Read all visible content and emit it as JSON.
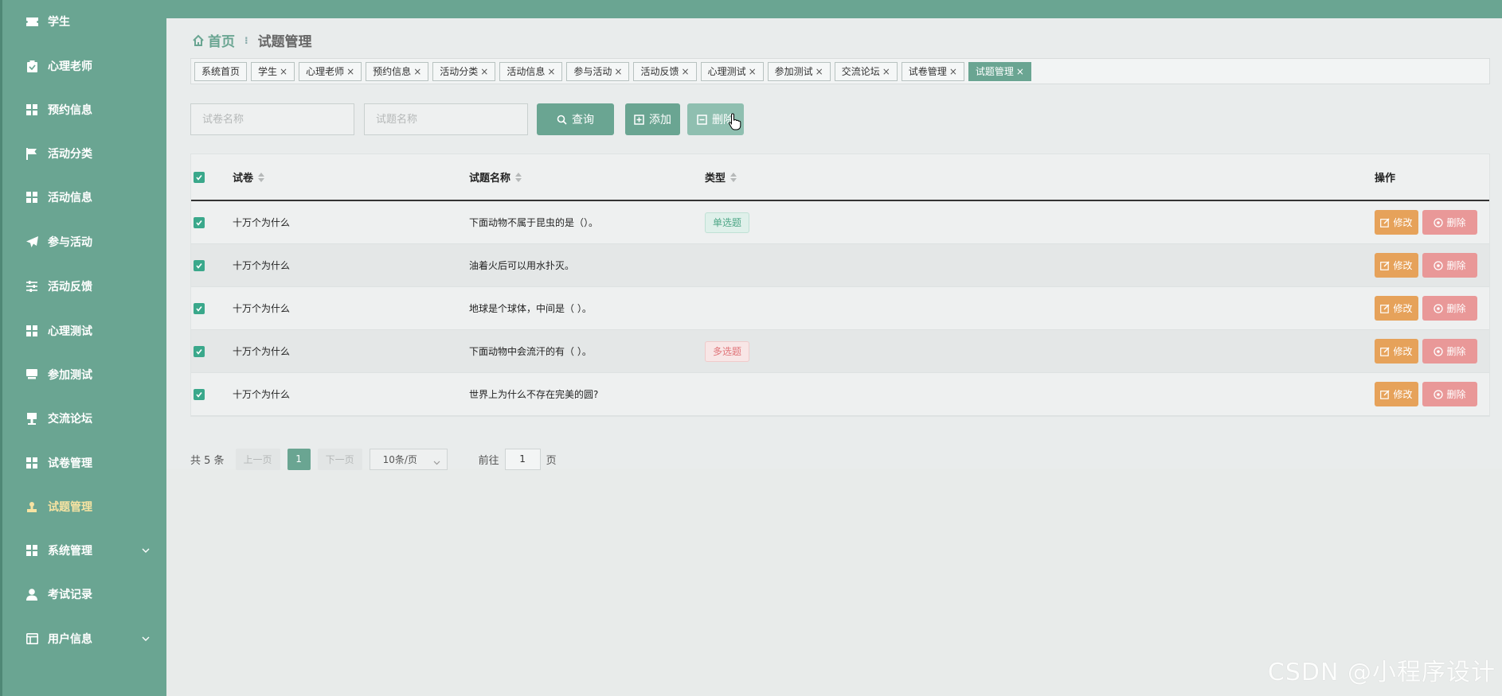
{
  "sidebar": {
    "items": [
      {
        "label": "学生",
        "icon": "ticket-icon"
      },
      {
        "label": "心理老师",
        "icon": "clipboard-icon"
      },
      {
        "label": "预约信息",
        "icon": "grid-icon"
      },
      {
        "label": "活动分类",
        "icon": "flag-icon"
      },
      {
        "label": "活动信息",
        "icon": "grid-icon"
      },
      {
        "label": "参与活动",
        "icon": "send-icon"
      },
      {
        "label": "活动反馈",
        "icon": "sliders-icon"
      },
      {
        "label": "心理测试",
        "icon": "grid-icon"
      },
      {
        "label": "参加测试",
        "icon": "monitor-icon"
      },
      {
        "label": "交流论坛",
        "icon": "podium-icon"
      },
      {
        "label": "试卷管理",
        "icon": "grid-icon"
      },
      {
        "label": "试题管理",
        "icon": "user-stamp-icon",
        "active": true
      },
      {
        "label": "系统管理",
        "icon": "grid-icon",
        "expandable": true
      },
      {
        "label": "考试记录",
        "icon": "person-icon"
      },
      {
        "label": "用户信息",
        "icon": "window-icon",
        "expandable": true
      }
    ]
  },
  "breadcrumb": {
    "home": "首页",
    "current": "试题管理"
  },
  "tags": [
    {
      "label": "系统首页",
      "closable": false
    },
    {
      "label": "学生",
      "closable": true
    },
    {
      "label": "心理老师",
      "closable": true
    },
    {
      "label": "预约信息",
      "closable": true
    },
    {
      "label": "活动分类",
      "closable": true
    },
    {
      "label": "活动信息",
      "closable": true
    },
    {
      "label": "参与活动",
      "closable": true
    },
    {
      "label": "活动反馈",
      "closable": true
    },
    {
      "label": "心理测试",
      "closable": true
    },
    {
      "label": "参加测试",
      "closable": true
    },
    {
      "label": "交流论坛",
      "closable": true
    },
    {
      "label": "试卷管理",
      "closable": true
    },
    {
      "label": "试题管理",
      "closable": true,
      "active": true
    }
  ],
  "search": {
    "paper_placeholder": "试卷名称",
    "question_placeholder": "试题名称",
    "query_label": "查询",
    "add_label": "添加",
    "delete_label": "删除"
  },
  "table": {
    "headers": {
      "paper": "试卷",
      "question": "试题名称",
      "type": "类型",
      "ops": "操作"
    },
    "edit_label": "修改",
    "delete_label": "删除",
    "rows": [
      {
        "paper": "十万个为什么",
        "question": "下面动物不属于昆虫的是（）。",
        "type": "单选题",
        "type_style": "single"
      },
      {
        "paper": "十万个为什么",
        "question": "油着火后可以用水扑灭。",
        "type": "",
        "type_style": ""
      },
      {
        "paper": "十万个为什么",
        "question": "地球是个球体，中间是（ ）。",
        "type": "",
        "type_style": ""
      },
      {
        "paper": "十万个为什么",
        "question": "下面动物中会流汗的有（ ）。",
        "type": "多选题",
        "type_style": "multi"
      },
      {
        "paper": "十万个为什么",
        "question": "世界上为什么不存在完美的圆?",
        "type": "",
        "type_style": ""
      }
    ]
  },
  "pagination": {
    "total": "共 5 条",
    "prev": "上一页",
    "page": "1",
    "next": "下一页",
    "page_size": "10条/页",
    "goto_prefix": "前往",
    "goto_value": "1",
    "goto_suffix": "页"
  },
  "watermark": "CSDN @小程序设计",
  "colors": {
    "primary": "#6aa592",
    "edit": "#e6a25a",
    "delete": "#e99898"
  }
}
